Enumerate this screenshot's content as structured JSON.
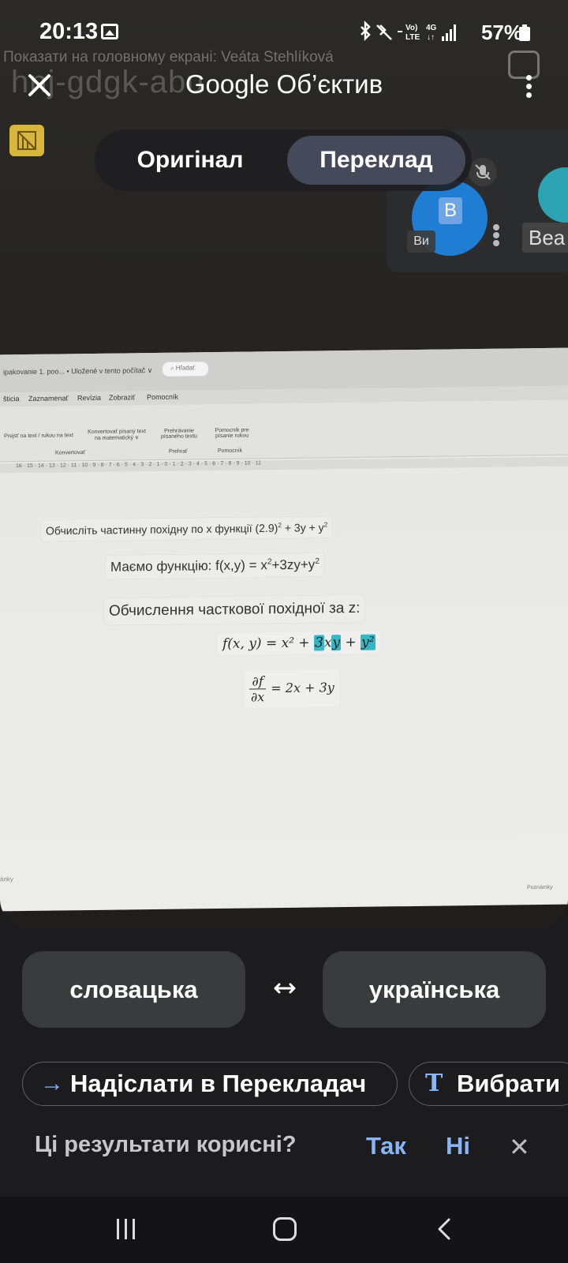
{
  "status_bar": {
    "time": "20:13",
    "battery": "57%",
    "network": "LTE 4G"
  },
  "photo": {
    "bg_banner": "Показати на головному екрані: Veáta Stehlíková",
    "bg_code": "hnj-gdgk-abu",
    "meet_initial": "B",
    "meet_self_label": "Ви",
    "meet_other_label": "Bea"
  },
  "top_bar": {
    "title": "Google Об’єктив",
    "close_icon": "close-icon",
    "more_icon": "more-vert-icon"
  },
  "mode_toggle": {
    "options": [
      "Оригінал",
      "Переклад"
    ],
    "selected": "Переклад"
  },
  "screen": {
    "ribbon_title": "ipakovanie 1. poo...  • Uložené v tento počítač ∨",
    "search_placeholder": "Hľadať",
    "menu": [
      "šticia",
      "Zaznamenať",
      "Revízia",
      "Zobraziť",
      "Pomocník"
    ],
    "tools": [
      "Prejsť na text / rukou na text",
      "Konvertovať písaný text na matematický ∨",
      "Prehrávanie písaného textu",
      "Pomocník pre písanie rukou"
    ],
    "groups": [
      "Konvertovať",
      "Prehrať",
      "Pomocník"
    ],
    "line1": "Обчисліть частинну похідну по x функції (2.9)",
    "line1_tail": " + 3y + y",
    "line2": "Маємо функцію: f(x,y) = x",
    "line2_tail": "+3zy+y",
    "line3": "Обчислення часткової похідної за z:",
    "eq1_left": "f(x, y) = x² + ",
    "eq1_h1": "3",
    "eq1_mid": "x",
    "eq1_h2": "y",
    "eq1_plus": " + ",
    "eq1_h3": "y²",
    "eq2_num": "∂f",
    "eq2_den": "∂x",
    "eq2_right": "= 2x + 3y",
    "footer_left": "ánky",
    "footer_right": "Poznámky"
  },
  "languages": {
    "source": "словацька",
    "target": "українська"
  },
  "actions": {
    "send_translate": "Надіслати в Перекладач",
    "select_text": "Вибрати"
  },
  "feedback": {
    "question": "Ці результати корисні?",
    "yes": "Так",
    "no": "Ні"
  },
  "colors": {
    "accent": "#8ab4f8",
    "toggle_active": "#454a5b",
    "chip_bg": "#3a3b3d",
    "background": "#1c1c1e",
    "highlight": "#35b7c6"
  }
}
